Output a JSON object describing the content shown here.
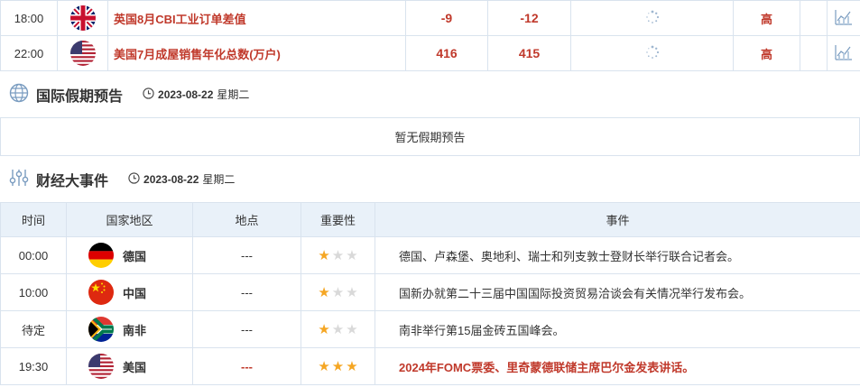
{
  "economic_data": {
    "rows": [
      {
        "time": "18:00",
        "flag": "uk",
        "indicator": "英国8月CBI工业订单差值",
        "previous": "-9",
        "forecast": "-12",
        "importance": "高"
      },
      {
        "time": "22:00",
        "flag": "us",
        "indicator": "美国7月成屋销售年化总数(万户)",
        "previous": "416",
        "forecast": "415",
        "importance": "高"
      }
    ]
  },
  "holiday_section": {
    "title": "国际假期预告",
    "date": "2023-08-22",
    "weekday": "星期二",
    "empty_text": "暂无假期预告"
  },
  "events_section": {
    "title": "财经大事件",
    "date": "2023-08-22",
    "weekday": "星期二",
    "headers": {
      "time": "时间",
      "country": "国家地区",
      "place": "地点",
      "importance": "重要性",
      "event": "事件"
    },
    "rows": [
      {
        "time": "00:00",
        "flag": "de",
        "country": "德国",
        "place": "---",
        "stars": 1,
        "event": "德国、卢森堡、奥地利、瑞士和列支敦士登财长举行联合记者会。",
        "highlight": false
      },
      {
        "time": "10:00",
        "flag": "cn",
        "country": "中国",
        "place": "---",
        "stars": 1,
        "event": "国新办就第二十三届中国国际投资贸易洽谈会有关情况举行发布会。",
        "highlight": false
      },
      {
        "time": "待定",
        "flag": "za",
        "country": "南非",
        "place": "---",
        "stars": 1,
        "event": "南非举行第15届金砖五国峰会。",
        "highlight": false
      },
      {
        "time": "19:30",
        "flag": "us",
        "country": "美国",
        "place": "---",
        "stars": 3,
        "event": "2024年FOMC票委、里奇蒙德联储主席巴尔金发表讲话。",
        "highlight": true
      }
    ]
  },
  "colors": {
    "accent_red": "#c0392b",
    "star_on": "#f5a623",
    "star_off": "#d9d9d9",
    "header_bg": "#e9f1f9",
    "border": "#d9e3ee"
  }
}
